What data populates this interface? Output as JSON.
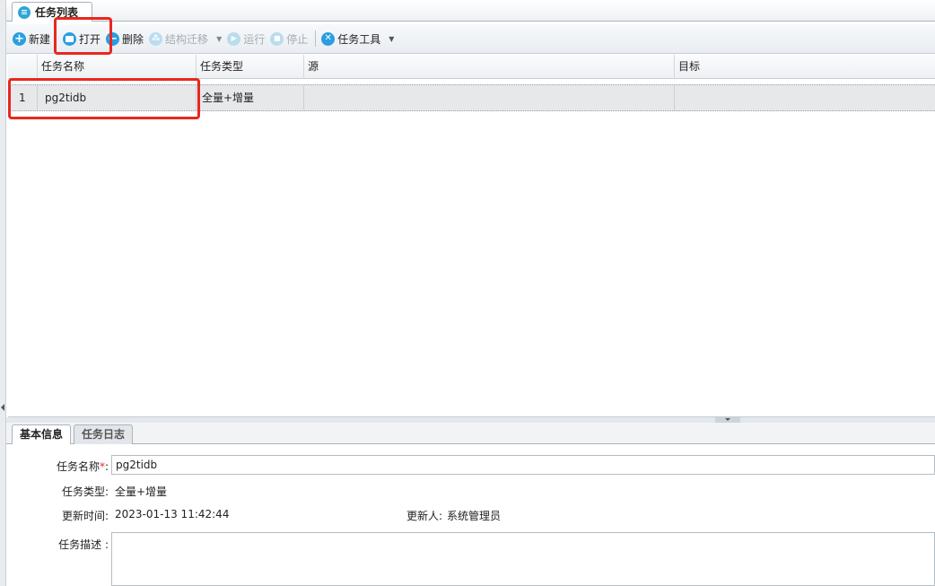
{
  "window_tab": {
    "title": "任务列表"
  },
  "toolbar": {
    "new_label": "新建",
    "open_label": "打开",
    "delete_label": "删除",
    "migrate_label": "结构迁移",
    "run_label": "运行",
    "stop_label": "停止",
    "tools_label": "任务工具"
  },
  "grid": {
    "columns": [
      "任务名称",
      "任务类型",
      "源",
      "目标"
    ],
    "rows": [
      {
        "index": "1",
        "name": "pg2tidb",
        "type": "全量+增量",
        "source": "",
        "target": ""
      }
    ]
  },
  "bottom_tabs": [
    "基本信息",
    "任务日志"
  ],
  "form": {
    "name_label": "任务名称",
    "name_required": "*",
    "name_colon": ":",
    "name_value": "pg2tidb",
    "type_label": "任务类型:",
    "type_value": "全量+增量",
    "updated_label": "更新时间:",
    "updated_value": "2023-01-13 11:42:44",
    "updater_label": "更新人:",
    "updater_value": "系统管理员",
    "desc_label": "任务描述 :",
    "desc_value": ""
  },
  "colors": {
    "accent": "#2a9ee0",
    "highlight": "#e8271f"
  }
}
